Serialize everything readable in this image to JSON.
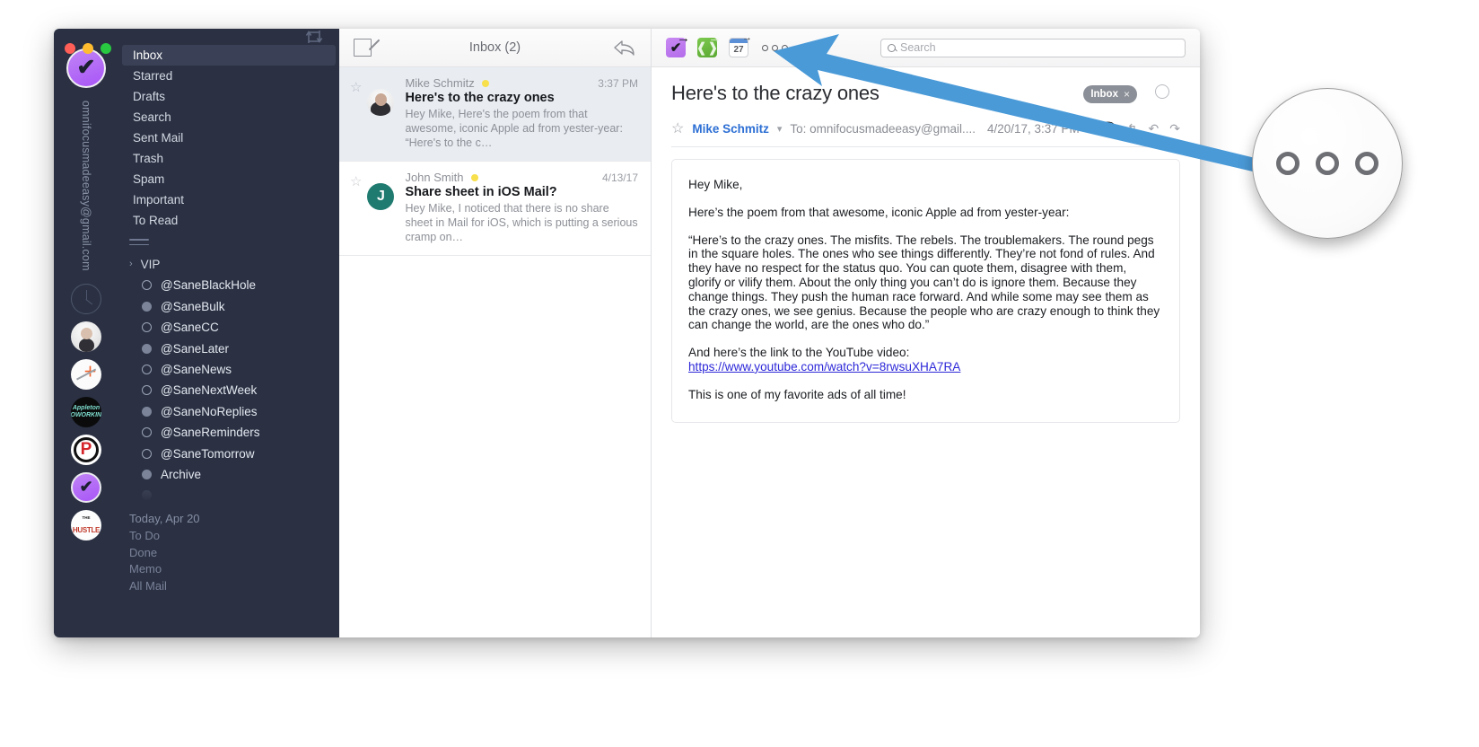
{
  "window": {
    "traffic_lights": [
      "close",
      "minimize",
      "zoom"
    ],
    "sync_icon": "sync-icon"
  },
  "sidebar": {
    "account": {
      "avatar_icon": "omnifocus-checkmark-avatar",
      "email": "omnifocusmadeeasy@gmail.com"
    },
    "folders": [
      {
        "label": "Inbox",
        "selected": true
      },
      {
        "label": "Starred",
        "selected": false
      },
      {
        "label": "Drafts",
        "selected": false
      },
      {
        "label": "Search",
        "selected": false
      },
      {
        "label": "Sent Mail",
        "selected": false
      },
      {
        "label": "Trash",
        "selected": false
      },
      {
        "label": "Spam",
        "selected": false
      },
      {
        "label": "Important",
        "selected": false
      },
      {
        "label": "To Read",
        "selected": false
      }
    ],
    "vip": {
      "label": "VIP",
      "chevron": "chevron-right-icon"
    },
    "labels": [
      {
        "label": "@SaneBlackHole",
        "dot": "hollow"
      },
      {
        "label": "@SaneBulk",
        "dot": "solid"
      },
      {
        "label": "@SaneCC",
        "dot": "hollow"
      },
      {
        "label": "@SaneLater",
        "dot": "solid"
      },
      {
        "label": "@SaneNews",
        "dot": "hollow"
      },
      {
        "label": "@SaneNextWeek",
        "dot": "hollow"
      },
      {
        "label": "@SaneNoReplies",
        "dot": "solid"
      },
      {
        "label": "@SaneReminders",
        "dot": "hollow"
      },
      {
        "label": "@SaneTomorrow",
        "dot": "hollow"
      },
      {
        "label": "Archive",
        "dot": "solid"
      }
    ],
    "footer": [
      {
        "label": "Today, Apr 20",
        "kind": "head"
      },
      {
        "label": "To Do",
        "kind": "item"
      },
      {
        "label": "Done",
        "kind": "item"
      },
      {
        "label": "Memo",
        "kind": "item"
      },
      {
        "label": "All Mail",
        "kind": "item"
      }
    ],
    "rail_icons": [
      "clock-icon",
      "contact-photo-avatar",
      "sketch-avatar",
      "appleton-coworking-avatar",
      "podcast-p-avatar",
      "omnifocus-avatar",
      "hustle-avatar"
    ]
  },
  "messagelist": {
    "compose_icon": "compose-icon",
    "title": "Inbox (2)",
    "reply_icon": "reply-arrow-icon",
    "messages": [
      {
        "sender": "Mike Schmitz",
        "time": "3:37 PM",
        "subject": "Here's to the crazy ones",
        "snippet": "Hey Mike, Here's the poem from that awesome, iconic Apple ad from yester-year: “Here's to the c…",
        "avatar_kind": "photo",
        "avatar_initial": "",
        "selected": true,
        "unread_dot": "#f7e04b"
      },
      {
        "sender": "John Smith",
        "time": "4/13/17",
        "subject": "Share sheet in iOS Mail?",
        "snippet": "Hey Mike, I noticed that there is no share sheet in Mail for iOS, which is putting a serious cramp on…",
        "avatar_kind": "initial",
        "avatar_initial": "J",
        "selected": false,
        "unread_dot": "#f7e04b"
      }
    ]
  },
  "reader": {
    "toolbar": {
      "omnifocus_label": "✔",
      "evernote_label": "◔",
      "calendar_day": "27",
      "more_menu": "three-dots-menu"
    },
    "search": {
      "placeholder": "Search",
      "value": ""
    },
    "title": "Here's to the crazy ones",
    "inbox_chip": {
      "label": "Inbox",
      "remove": "×"
    },
    "meta": {
      "from": "Mike Schmitz",
      "to": "To: omnifocusmadeeasy@gmail....",
      "date": "4/20/17, 3:37 PM"
    },
    "body": {
      "greeting": "Hey Mike,",
      "intro": "Here’s the poem from that awesome, iconic Apple ad from yester-year:",
      "quote": "“Here’s to the crazy ones. The misfits. The rebels. The troublemakers. The round pegs in the square holes. The ones who see things differently. They’re not fond of rules. And they have no respect for the status quo. You can quote them, disagree with them, glorify or vilify them. About the only thing you can’t do is ignore them. Because they change things. They push the human race forward. And while some may see them as the crazy ones, we see genius. Because the people who are crazy enough to think they can change the world, are the ones who do.”",
      "link_intro": "And here’s the link to the YouTube video:",
      "link_text": "https://www.youtube.com/watch?v=8rwsuXHA7RA",
      "closing": "This is one of my favorite ads of all time!"
    }
  },
  "callout": {
    "target": "three-dots-menu",
    "arrow_color": "#4a9ad8",
    "magnified_icon": "three-circles-icon"
  }
}
